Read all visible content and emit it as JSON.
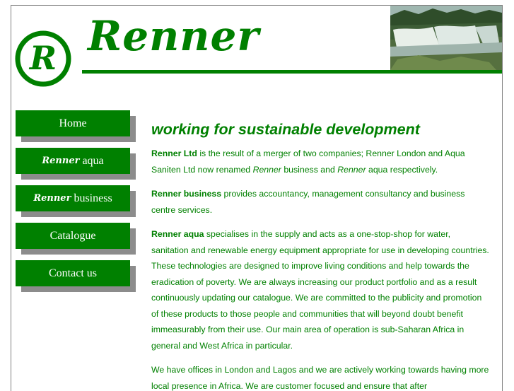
{
  "header": {
    "logo_letter": "R",
    "wordmark": "Renner",
    "photo_alt": "waterfall"
  },
  "colors": {
    "brand_green": "#008000",
    "shadow_grey": "#8c8c8c",
    "border_grey": "#808080"
  },
  "nav": [
    {
      "brand": "",
      "label": "Home"
    },
    {
      "brand": "Renner",
      "label": "aqua"
    },
    {
      "brand": "Renner",
      "label": "business"
    },
    {
      "brand": "",
      "label": "Catalogue"
    },
    {
      "brand": "",
      "label": "Contact us"
    }
  ],
  "main": {
    "heading": "working for sustainable development",
    "p1": {
      "b1": "Renner Ltd",
      "t1": " is the result of a merger of two companies; Renner London and Aqua Saniten Ltd now renamed ",
      "i1": "Renner",
      "t2": " business and ",
      "i2": "Renner",
      "t3": " aqua respectively."
    },
    "p2": {
      "b1": "Renner business",
      "t1": " provides accountancy, management consultancy and business centre services."
    },
    "p3": {
      "b1": "Renner aqua",
      "t1": " specialises in the supply and acts as a one-stop-shop for water, sanitation and renewable energy equipment appropriate for use in developing countries. These technologies are designed to improve living conditions and help towards the eradication of poverty. We are always increasing our product portfolio and as a result continuously updating our catalogue. We are committed to the publicity and promotion of these products to those people and communities that will beyond doubt benefit immeasurably from their use. Our main area of operation is sub-Saharan Africa in general and West Africa in particular."
    },
    "p4": {
      "t1": "We have offices in London and Lagos and we are actively working towards having more local presence in Africa. We are customer focused and ensure that after"
    }
  }
}
